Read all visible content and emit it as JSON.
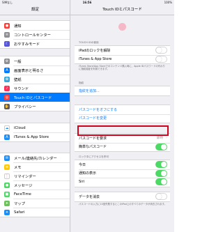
{
  "status": {
    "carrier": "SIMなし",
    "time": "16:56",
    "battery": "100%"
  },
  "left": {
    "title": "設定",
    "groups": [
      [
        {
          "label": "通知",
          "color": "#fc3d39",
          "icon": "bell-icon"
        },
        {
          "label": "コントロールセンター",
          "color": "#8e8e93",
          "icon": "toggles-icon"
        },
        {
          "label": "おやすみモード",
          "color": "#5856d6",
          "icon": "moon-icon"
        }
      ],
      [
        {
          "label": "一般",
          "color": "#8e8e93",
          "icon": "gear-icon"
        },
        {
          "label": "画面表示と明るさ",
          "color": "#007aff",
          "icon": "text-size-icon"
        },
        {
          "label": "壁紙",
          "color": "#35aadc",
          "icon": "flower-icon"
        },
        {
          "label": "サウンド",
          "color": "#fc3158",
          "icon": "speaker-icon"
        },
        {
          "label": "Touch IDとパスコード",
          "color": "#fc3d39",
          "icon": "fingerprint-icon",
          "selected": true
        },
        {
          "label": "プライバシー",
          "color": "#5b5b60",
          "icon": "hand-icon"
        }
      ],
      [
        {
          "label": "iCloud",
          "color": "#ffffff",
          "icon": "cloud-icon"
        },
        {
          "label": "iTunes & App Store",
          "color": "#1c8ef9",
          "icon": "app-store-icon"
        }
      ],
      [
        {
          "label": "メール/連絡先/カレンダー",
          "color": "#1b8df6",
          "icon": "mail-icon"
        },
        {
          "label": "メモ",
          "color": "#ffcc00",
          "icon": "notes-icon"
        },
        {
          "label": "リマインダー",
          "color": "#ffffff",
          "icon": "reminders-icon"
        },
        {
          "label": "メッセージ",
          "color": "#4cd964",
          "icon": "messages-icon"
        },
        {
          "label": "FaceTime",
          "color": "#4cd964",
          "icon": "facetime-icon"
        },
        {
          "label": "マップ",
          "color": "#6ac259",
          "icon": "maps-icon"
        },
        {
          "label": "Safari",
          "color": "#1c8ef9",
          "icon": "compass-icon"
        }
      ]
    ]
  },
  "right": {
    "title": "Touch IDとパスコード",
    "section_use": "TOUCH IDの使用",
    "unlock_label": "iPadのロックを解除",
    "itunes_label": "iTunes & App Store",
    "footnote1": "iTunes Store/App Storeでのコンテンツ購入時に、Apple IDパスワードの代わりに指紋認証を利用できます。",
    "section_fingerprint": "指紋",
    "add_fingerprint": "指紋を追加...",
    "passcode_off": "パスコードをオフにする",
    "passcode_change": "パスコードを変更",
    "require_passcode": "パスコードを要求",
    "require_value": "即時",
    "simple_passcode": "簡単なパスコード",
    "section_locked": "ロック中にアクセスを許可",
    "today": "今日",
    "notifications_view": "通知の表示",
    "siri": "Siri",
    "erase_data": "データを消去",
    "footnote2": "パスコードの入力に10回失敗するとこのiPad上のすべてのデータが消去されます。"
  }
}
